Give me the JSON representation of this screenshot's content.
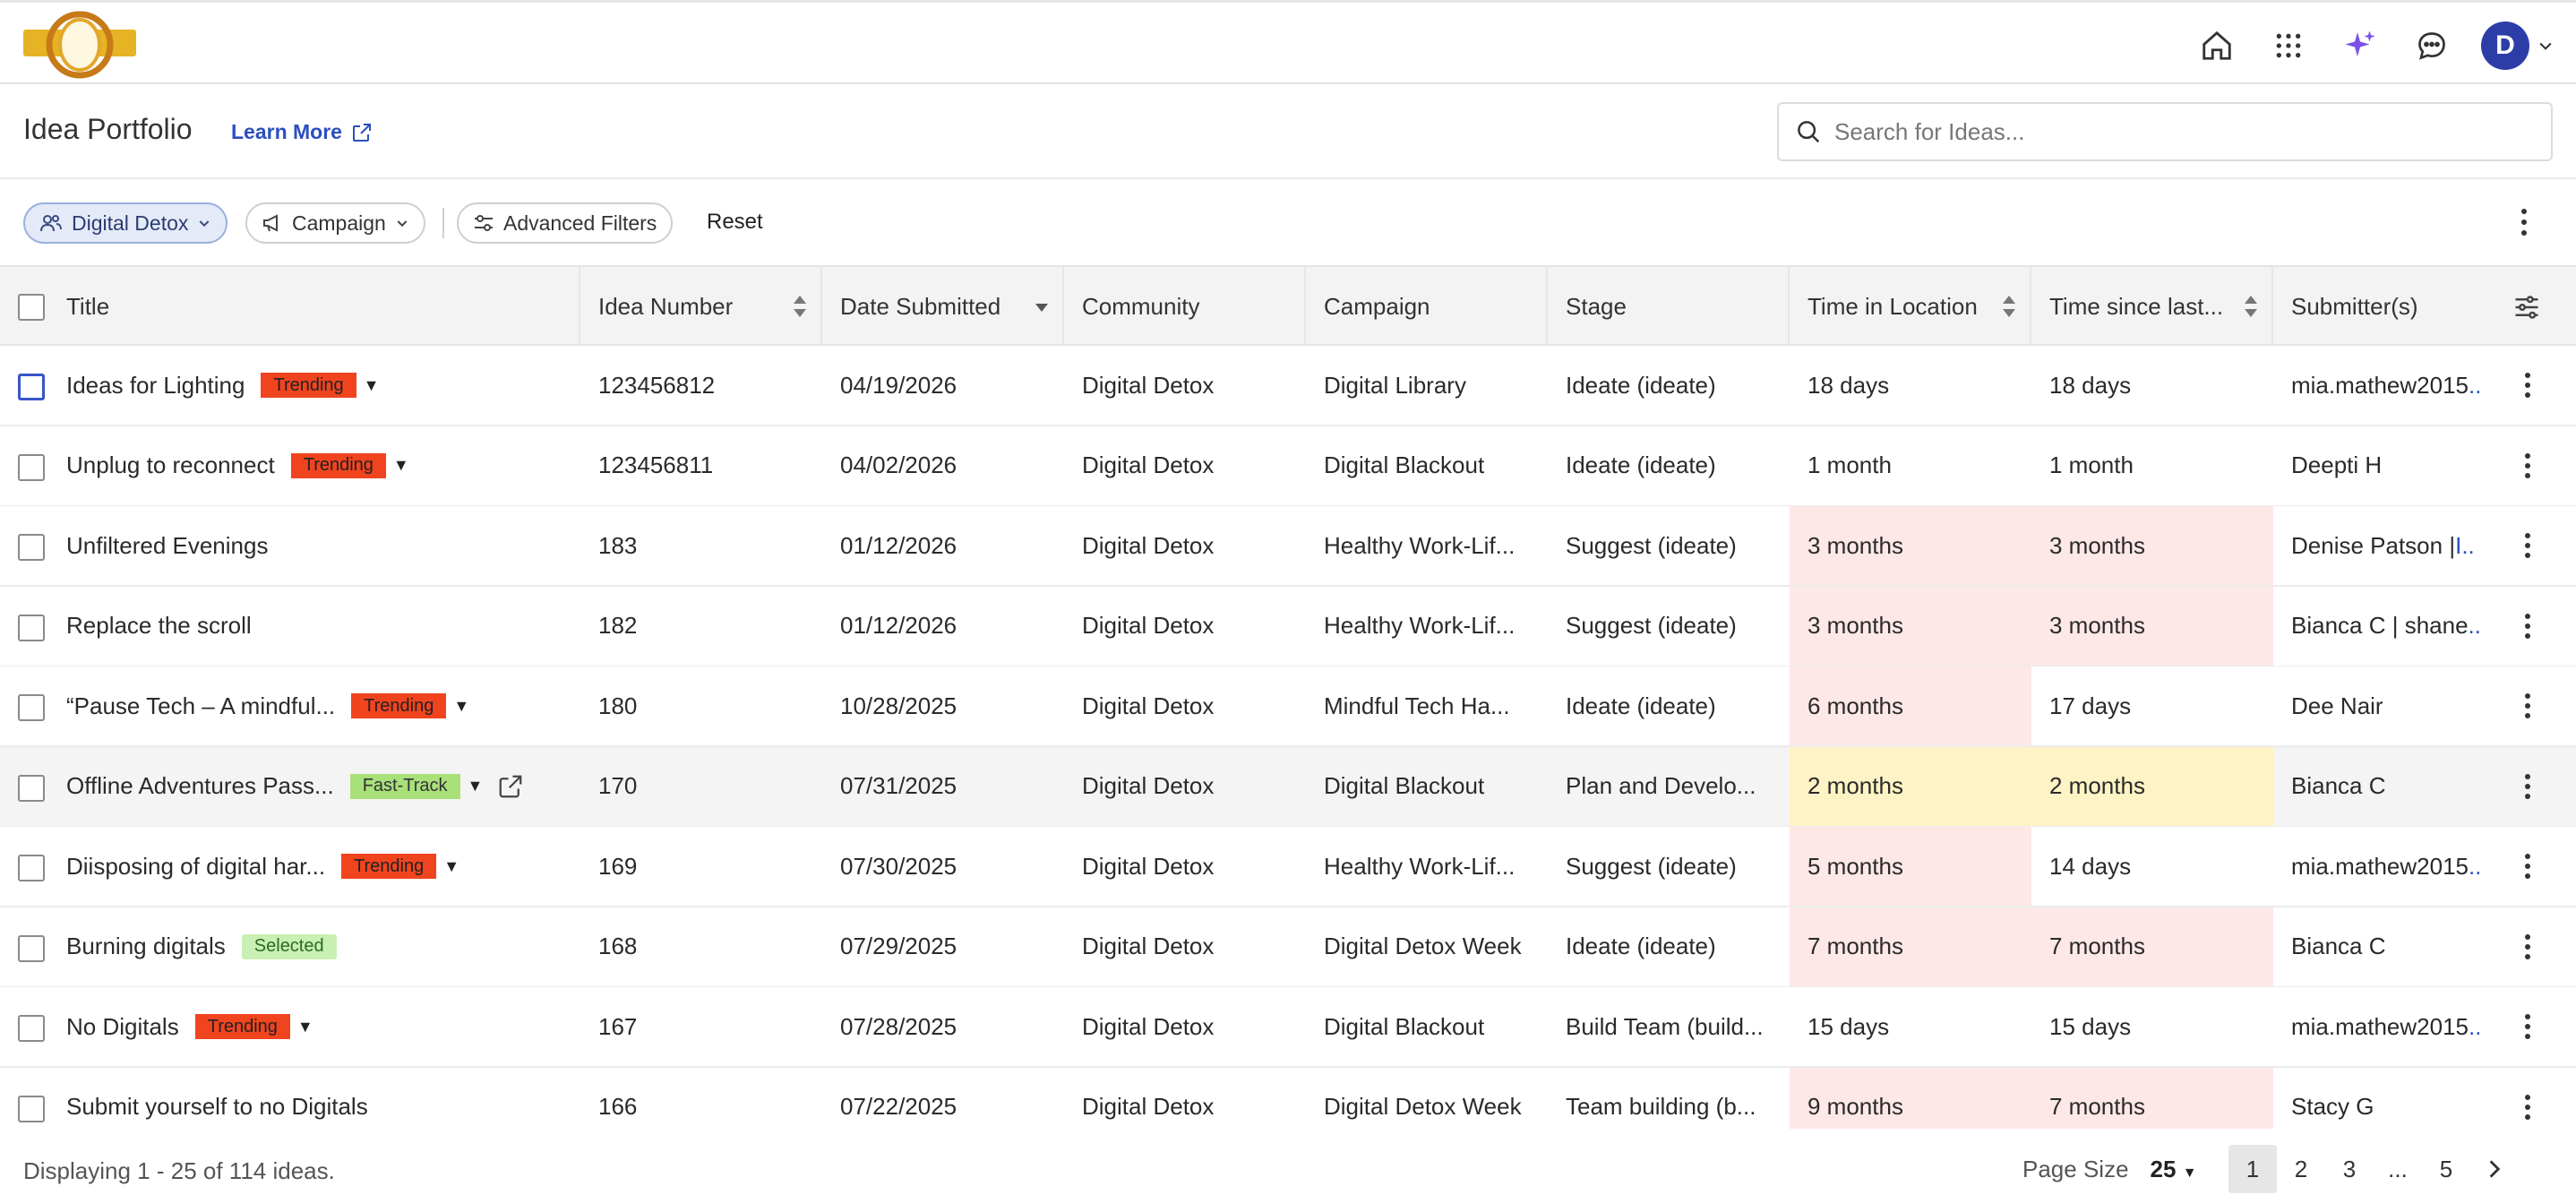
{
  "topbar": {
    "icons": [
      "home-icon",
      "apps-grid-icon",
      "sparkle-ai-icon",
      "chat-icon"
    ],
    "avatar_initial": "D"
  },
  "header": {
    "title": "Idea Portfolio",
    "learn_more": "Learn More",
    "search_placeholder": "Search for Ideas..."
  },
  "filters": {
    "community": "Digital Detox",
    "campaign": "Campaign",
    "advanced": "Advanced Filters",
    "reset": "Reset"
  },
  "table": {
    "columns": [
      "Title",
      "Idea Number",
      "Date Submitted",
      "Community",
      "Campaign",
      "Stage",
      "Time in Location",
      "Time since last...",
      "Submitter(s)"
    ],
    "rows": [
      {
        "title": "Ideas for Lighting",
        "badge": "Trending",
        "number": "123456812",
        "date": "04/19/2026",
        "community": "Digital Detox",
        "campaign": "Digital Library",
        "stage": "Ideate (ideate)",
        "tloc": "18 days",
        "tlast": "18 days",
        "submitter": "mia.mathew2015",
        "ell": "..",
        "tloc_color": "none",
        "tlast_color": "none"
      },
      {
        "title": "Unplug to reconnect",
        "badge": "Trending",
        "number": "123456811",
        "date": "04/02/2026",
        "community": "Digital Detox",
        "campaign": "Digital Blackout",
        "stage": "Ideate (ideate)",
        "tloc": "1 month",
        "tlast": "1 month",
        "submitter": "Deepti H",
        "ell": "",
        "tloc_color": "none",
        "tlast_color": "none"
      },
      {
        "title": "Unfiltered Evenings",
        "badge": "",
        "number": "183",
        "date": "01/12/2026",
        "community": "Digital Detox",
        "campaign": "Healthy Work-Lif...",
        "stage": "Suggest (ideate)",
        "tloc": "3 months",
        "tlast": "3 months",
        "submitter": "Denise Patson | ",
        "ell": "I..",
        "tloc_color": "pink",
        "tlast_color": "pink"
      },
      {
        "title": "Replace the scroll",
        "badge": "",
        "number": "182",
        "date": "01/12/2026",
        "community": "Digital Detox",
        "campaign": "Healthy Work-Lif...",
        "stage": "Suggest (ideate)",
        "tloc": "3 months",
        "tlast": "3 months",
        "submitter": "Bianca C | shane",
        "ell": "..",
        "tloc_color": "pink",
        "tlast_color": "pink"
      },
      {
        "title": "“Pause Tech – A mindful...",
        "badge": "Trending",
        "number": "180",
        "date": "10/28/2025",
        "community": "Digital Detox",
        "campaign": "Mindful Tech Ha...",
        "stage": "Ideate (ideate)",
        "tloc": "6 months",
        "tlast": "17 days",
        "submitter": "Dee Nair",
        "ell": "",
        "tloc_color": "pink",
        "tlast_color": "none"
      },
      {
        "title": "Offline Adventures Pass...",
        "badge": "Fast-Track",
        "number": "170",
        "date": "07/31/2025",
        "community": "Digital Detox",
        "campaign": "Digital Blackout",
        "stage": "Plan and Develo...",
        "tloc": "2 months",
        "tlast": "2 months",
        "submitter": "Bianca C",
        "ell": "",
        "tloc_color": "yellow",
        "tlast_color": "yellow"
      },
      {
        "title": "Diisposing of digital har...",
        "badge": "Trending",
        "number": "169",
        "date": "07/30/2025",
        "community": "Digital Detox",
        "campaign": "Healthy Work-Lif...",
        "stage": "Suggest (ideate)",
        "tloc": "5 months",
        "tlast": "14 days",
        "submitter": "mia.mathew2015",
        "ell": "..",
        "tloc_color": "pink",
        "tlast_color": "none"
      },
      {
        "title": "Burning digitals",
        "badge": "Selected",
        "number": "168",
        "date": "07/29/2025",
        "community": "Digital Detox",
        "campaign": "Digital Detox Week",
        "stage": "Ideate (ideate)",
        "tloc": "7 months",
        "tlast": "7 months",
        "submitter": "Bianca C",
        "ell": "",
        "tloc_color": "pink",
        "tlast_color": "pink"
      },
      {
        "title": "No Digitals",
        "badge": "Trending",
        "number": "167",
        "date": "07/28/2025",
        "community": "Digital Detox",
        "campaign": "Digital Blackout",
        "stage": "Build Team (build...",
        "tloc": "15 days",
        "tlast": "15 days",
        "submitter": "mia.mathew2015",
        "ell": "..",
        "tloc_color": "none",
        "tlast_color": "none"
      },
      {
        "title": "Submit yourself to no Digitals",
        "badge": "",
        "number": "166",
        "date": "07/22/2025",
        "community": "Digital Detox",
        "campaign": "Digital Detox Week",
        "stage": "Team building (b...",
        "tloc": "9 months",
        "tlast": "7 months",
        "submitter": "Stacy G",
        "ell": "",
        "tloc_color": "pink",
        "tlast_color": "pink"
      }
    ]
  },
  "footer": {
    "display": "Displaying 1 - 25 of 114 ideas.",
    "page_size_label": "Page Size",
    "page_size": "25",
    "pages": [
      "1",
      "2",
      "3",
      "...",
      "5"
    ]
  },
  "colors": {
    "accent": "#2b4fbf",
    "trending": "#f0441f",
    "fast_track": "#a8e07a",
    "selected": "#c9f0b3",
    "pink": "#fde7e7",
    "yellow": "#fdf3c4"
  }
}
